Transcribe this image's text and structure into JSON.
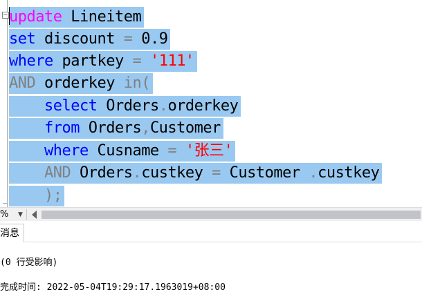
{
  "editor": {
    "lines": [
      [
        {
          "t": "update",
          "c": "kw-pink"
        },
        {
          "t": " Lineitem",
          "c": "txt"
        }
      ],
      [
        {
          "t": "set",
          "c": "kw-blue"
        },
        {
          "t": " discount ",
          "c": "txt"
        },
        {
          "t": "=",
          "c": "kw-gray"
        },
        {
          "t": " 0.9",
          "c": "txt"
        }
      ],
      [
        {
          "t": "where",
          "c": "kw-blue"
        },
        {
          "t": " partkey ",
          "c": "txt"
        },
        {
          "t": "=",
          "c": "kw-gray"
        },
        {
          "t": " ",
          "c": "txt"
        },
        {
          "t": "'111'",
          "c": "str"
        }
      ],
      [
        {
          "t": "AND",
          "c": "kw-gray"
        },
        {
          "t": " orderkey ",
          "c": "txt"
        },
        {
          "t": "in(",
          "c": "kw-gray"
        }
      ],
      [
        {
          "t": "    ",
          "c": "txt"
        },
        {
          "t": "select",
          "c": "kw-blue"
        },
        {
          "t": " Orders",
          "c": "txt"
        },
        {
          "t": ".",
          "c": "kw-gray"
        },
        {
          "t": "orderkey",
          "c": "txt"
        }
      ],
      [
        {
          "t": "    ",
          "c": "txt"
        },
        {
          "t": "from",
          "c": "kw-blue"
        },
        {
          "t": " Orders",
          "c": "txt"
        },
        {
          "t": ",",
          "c": "kw-gray"
        },
        {
          "t": "Customer",
          "c": "txt"
        }
      ],
      [
        {
          "t": "    ",
          "c": "txt"
        },
        {
          "t": "where",
          "c": "kw-blue"
        },
        {
          "t": " Cusname ",
          "c": "txt"
        },
        {
          "t": "=",
          "c": "kw-gray"
        },
        {
          "t": " ",
          "c": "txt"
        },
        {
          "t": "'张三'",
          "c": "str"
        }
      ],
      [
        {
          "t": "    ",
          "c": "txt"
        },
        {
          "t": "AND",
          "c": "kw-gray"
        },
        {
          "t": " Orders",
          "c": "txt"
        },
        {
          "t": ".",
          "c": "kw-gray"
        },
        {
          "t": "custkey ",
          "c": "txt"
        },
        {
          "t": "=",
          "c": "kw-gray"
        },
        {
          "t": " Customer ",
          "c": "txt"
        },
        {
          "t": ".",
          "c": "kw-gray"
        },
        {
          "t": "custkey",
          "c": "txt"
        }
      ],
      [
        {
          "t": "    ",
          "c": "txt"
        },
        {
          "t": ");",
          "c": "kw-gray"
        }
      ]
    ]
  },
  "zoom": {
    "label": "%"
  },
  "tabs": {
    "messages_label": "消息"
  },
  "messages": {
    "rows_affected": "(0 行受影响)",
    "completion_time": "完成时间: 2022-05-04T19:29:17.1963019+08:00"
  },
  "colors": {
    "selection": "#99c9f1",
    "keyword_blue": "#0000ff",
    "keyword_pink": "#ff00ff",
    "operator_gray": "#808080",
    "string_red": "#ff0000"
  }
}
